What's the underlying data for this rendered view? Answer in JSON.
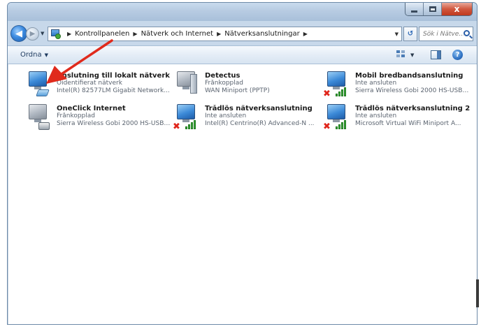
{
  "window": {
    "caption_buttons": [
      "minimize-icon",
      "maximize-icon",
      "close-icon"
    ],
    "close_glyph": "x"
  },
  "address_bar": {
    "crumbs": [
      "Kontrollpanelen",
      "Nätverk och Internet",
      "Nätverksanslutningar"
    ],
    "search_placeholder": "Sök i Nätve..."
  },
  "command_bar": {
    "organize_label": "Ordna",
    "help_glyph": "?"
  },
  "connections": [
    {
      "name": "Anslutning till lokalt nätverk",
      "status": "Oidentifierat nätverk",
      "device": "Intel(R) 82577LM Gigabit Network...",
      "icon": "ethernet-adapter-icon"
    },
    {
      "name": "Detectus",
      "status": "Frånkopplad",
      "device": "WAN Miniport (PPTP)",
      "icon": "vpn-connection-icon"
    },
    {
      "name": "Mobil bredbandsanslutning",
      "status": "Inte ansluten",
      "device": "Sierra Wireless Gobi 2000 HS-USB ...",
      "icon": "mobile-broadband-icon"
    },
    {
      "name": "OneClick Internet",
      "status": "Frånkopplad",
      "device": "Sierra Wireless Gobi 2000 HS-USB ...",
      "icon": "dialup-modem-icon"
    },
    {
      "name": "Trådlös nätverksanslutning",
      "status": "Inte ansluten",
      "device": "Intel(R) Centrino(R) Advanced-N ...",
      "icon": "wireless-adapter-icon"
    },
    {
      "name": "Trådlös nätverksanslutning 2",
      "status": "Inte ansluten",
      "device": "Microsoft Virtual WiFi Miniport A...",
      "icon": "wireless-adapter-icon"
    }
  ],
  "annotation": {
    "color": "#e02a1c",
    "icon": "red-arrow-annotation-icon"
  }
}
